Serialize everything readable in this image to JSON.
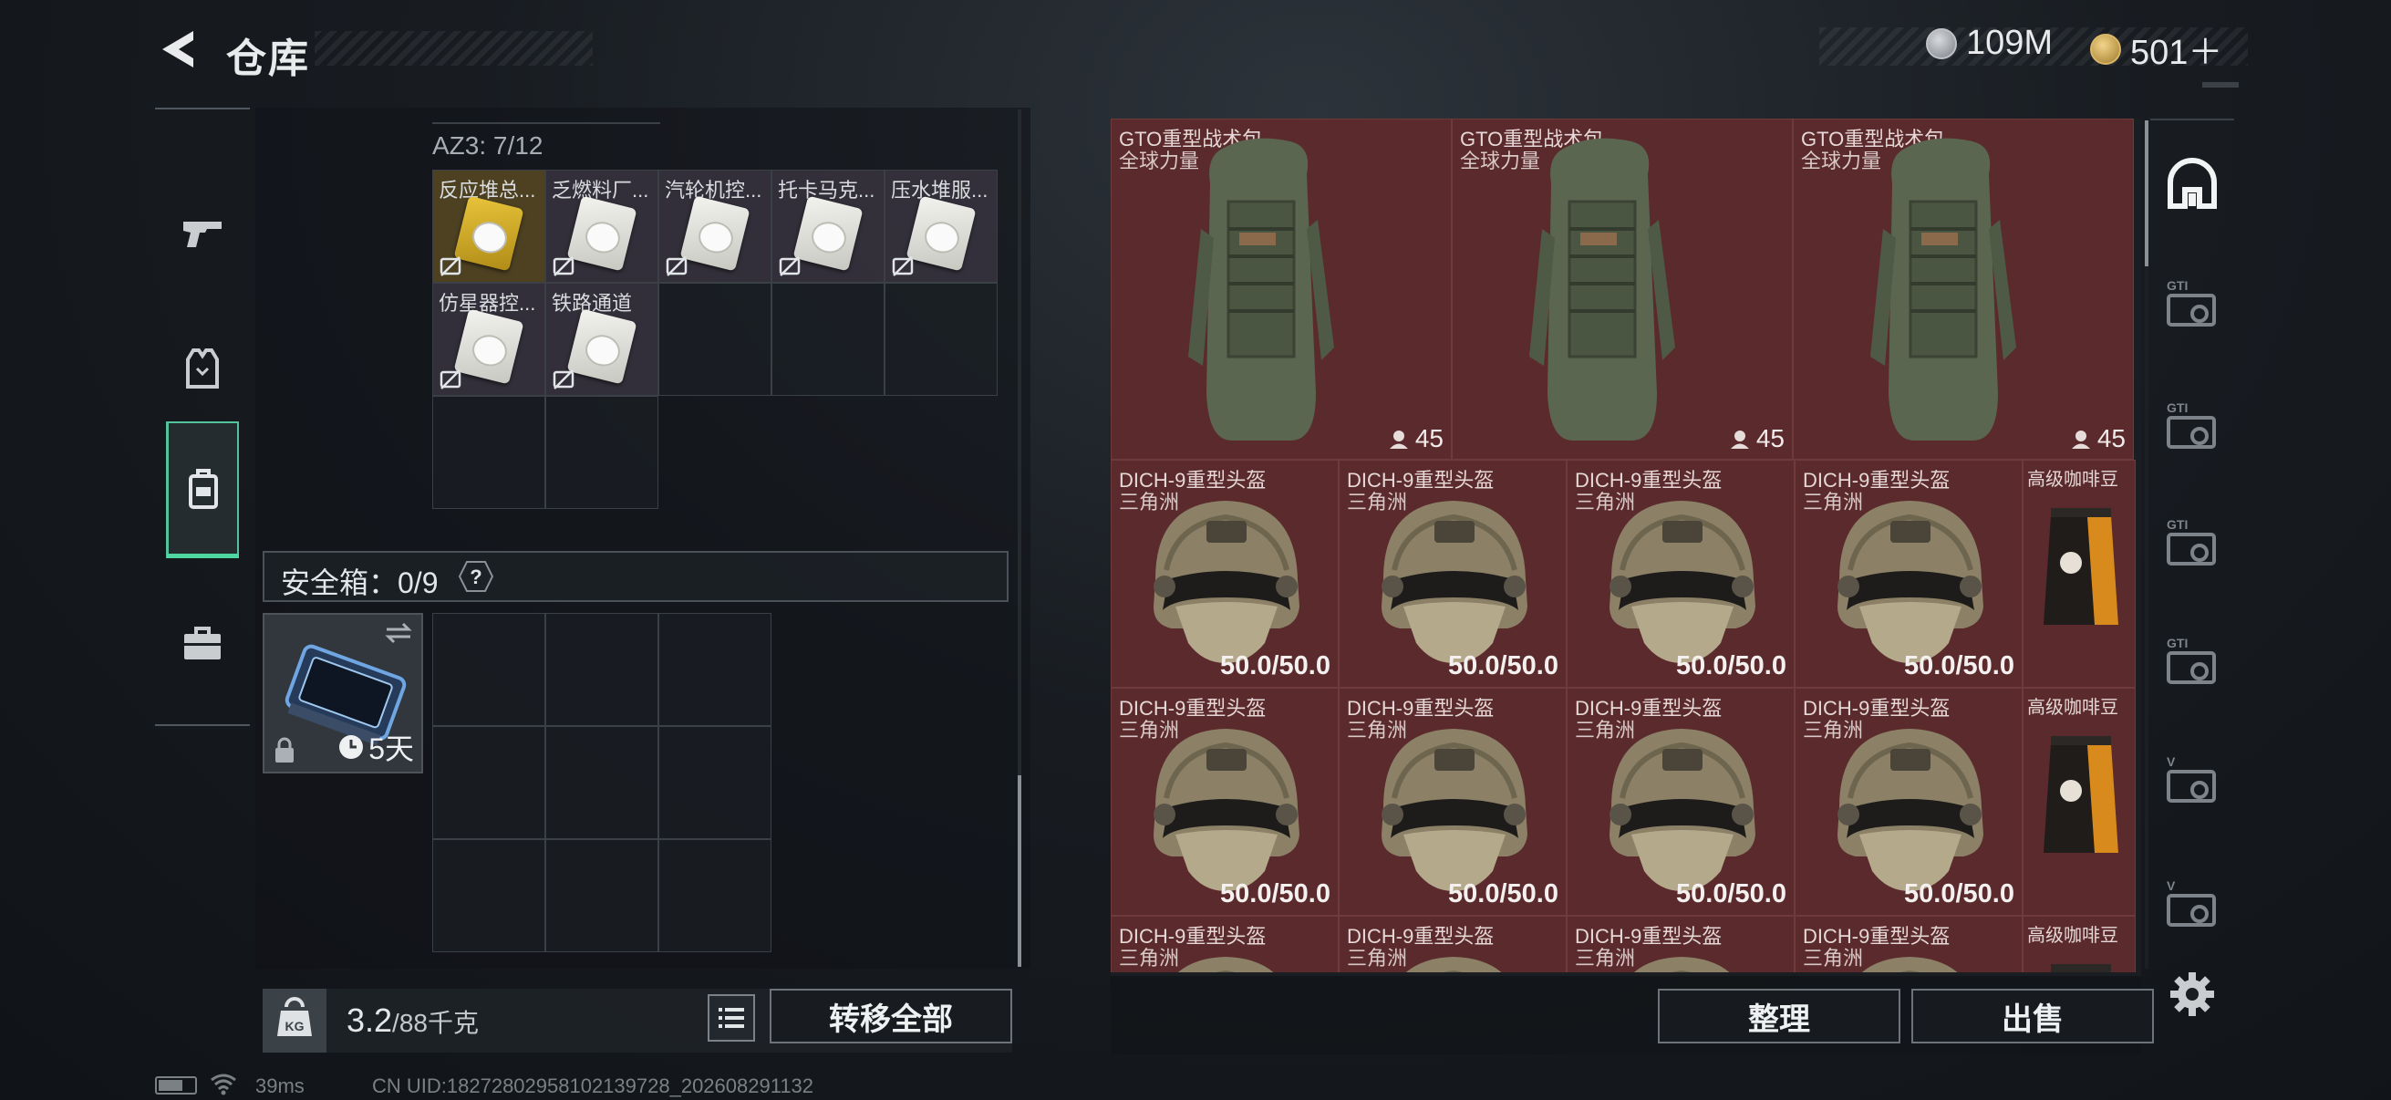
{
  "header": {
    "title": "仓库",
    "currency1": "109M",
    "currency2": "501＋"
  },
  "sidebar": {
    "items": [
      {
        "name": "weapons",
        "icon": "pistol-icon"
      },
      {
        "name": "equipment",
        "icon": "vest-icon"
      },
      {
        "name": "backpack",
        "icon": "backpack-icon",
        "active": true
      },
      {
        "name": "cases",
        "icon": "briefcase-icon"
      }
    ]
  },
  "inventory": {
    "container_label": "AZ3: 7/12",
    "items": [
      {
        "name": "反应堆总...",
        "variant": "gold"
      },
      {
        "name": "乏燃料厂...",
        "variant": "white"
      },
      {
        "name": "汽轮机控...",
        "variant": "white"
      },
      {
        "name": "托卡马克...",
        "variant": "white"
      },
      {
        "name": "压水堆服...",
        "variant": "white"
      },
      {
        "name": "仿星器控...",
        "variant": "white"
      },
      {
        "name": "铁路通道",
        "variant": "white"
      }
    ],
    "safe_label": "安全箱：0/9",
    "safe_help": "?",
    "safebox_timer": "5天"
  },
  "footer_left": {
    "weight_value": "3.2",
    "weight_unit": "/88千克",
    "kg_label": "KG",
    "transfer_all": "转移全部"
  },
  "stash": {
    "backpacks": [
      {
        "name": "GTO重型战术包",
        "faction": "全球力量",
        "count": "45"
      },
      {
        "name": "GTO重型战术包",
        "faction": "全球力量",
        "count": "45"
      },
      {
        "name": "GTO重型战术包",
        "faction": "全球力量",
        "count": "45"
      }
    ],
    "helmet_name": "DICH-9重型头盔",
    "helmet_faction": "三角洲",
    "helmet_durability": "50.0/50.0",
    "coffee_name": "高级咖啡豆",
    "sort_button": "整理",
    "sell_button": "出售"
  },
  "right_tabs": [
    "GTI",
    "GTI",
    "GTI",
    "GTI",
    "V",
    "V"
  ],
  "status_bar": {
    "ping": "39ms",
    "uid": "CN UID:18272802958102139728_202608291132"
  },
  "colors": {
    "accent_green": "#4ed7a0",
    "item_red": "#5a2a2c"
  }
}
